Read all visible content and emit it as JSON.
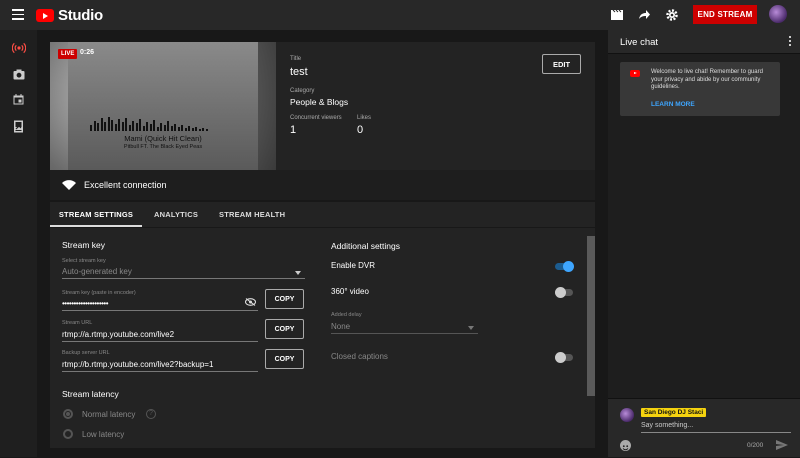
{
  "app": {
    "name": "Studio"
  },
  "topbar": {
    "end_stream_label": "END STREAM"
  },
  "video": {
    "live_label": "LIVE",
    "elapsed": "0:26",
    "song_title": "Mami (Quick Hit Clean)",
    "song_artist": "Pitbull FT. The Black Eyed Peas"
  },
  "stream_info": {
    "title_label": "Title",
    "title": "test",
    "category_label": "Category",
    "category": "People & Blogs",
    "viewers_label": "Concurrent viewers",
    "viewers": "1",
    "likes_label": "Likes",
    "likes": "0",
    "edit_label": "EDIT",
    "connection": "Excellent connection"
  },
  "tabs": [
    {
      "label": "STREAM SETTINGS",
      "active": true
    },
    {
      "label": "ANALYTICS",
      "active": false
    },
    {
      "label": "STREAM HEALTH",
      "active": false
    }
  ],
  "stream_key": {
    "section_title": "Stream key",
    "select_label": "Select stream key",
    "select_value": "Auto-generated key",
    "key_label": "Stream key (paste in encoder)",
    "key_value": "••••••••••••••••••••",
    "url_label": "Stream URL",
    "url_value": "rtmp://a.rtmp.youtube.com/live2",
    "backup_label": "Backup server URL",
    "backup_value": "rtmp://b.rtmp.youtube.com/live2?backup=1",
    "copy_label": "COPY"
  },
  "latency": {
    "section_title": "Stream latency",
    "normal_label": "Normal latency",
    "low_label": "Low latency"
  },
  "additional": {
    "section_title": "Additional settings",
    "dvr_label": "Enable DVR",
    "dvr_on": true,
    "video360_label": "360° video",
    "video360_on": false,
    "delay_label": "Added delay",
    "delay_value": "None",
    "captions_label": "Closed captions",
    "captions_on": false
  },
  "chat": {
    "title": "Live chat",
    "welcome_text": "Welcome to live chat! Remember to guard your privacy and abide by our community guidelines.",
    "learn_more": "LEARN MORE",
    "user_name": "San Diego DJ Staci",
    "placeholder": "Say something...",
    "counter": "0/200"
  },
  "colors": {
    "accent_red": "#cc0000",
    "link_blue": "#3ea6ff",
    "name_yellow": "#f5d30f"
  }
}
